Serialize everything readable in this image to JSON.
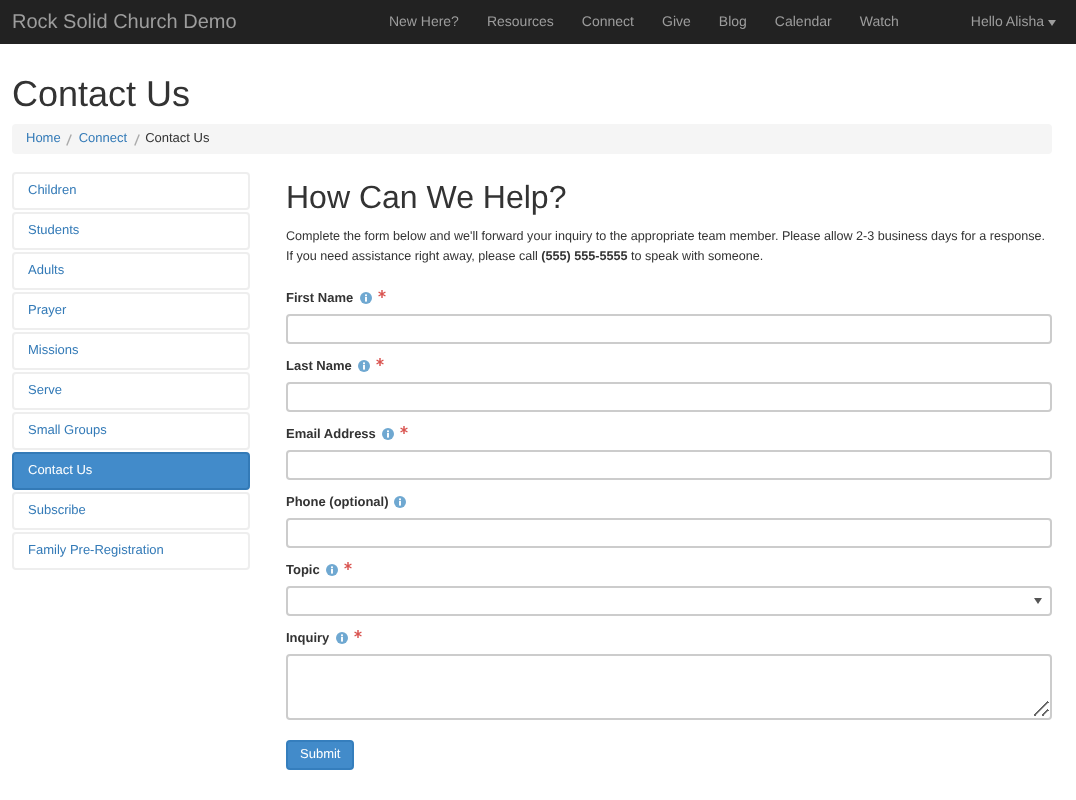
{
  "navbar": {
    "brand": "Rock Solid Church Demo",
    "links": [
      {
        "label": "New Here?"
      },
      {
        "label": "Resources"
      },
      {
        "label": "Connect"
      },
      {
        "label": "Give"
      },
      {
        "label": "Blog"
      },
      {
        "label": "Calendar"
      },
      {
        "label": "Watch"
      }
    ],
    "user": "Hello Alisha"
  },
  "page_title": "Contact Us",
  "breadcrumb": [
    {
      "label": "Home",
      "link": true
    },
    {
      "label": "Connect",
      "link": true
    },
    {
      "label": "Contact Us",
      "link": false
    }
  ],
  "sidebar": {
    "items": [
      {
        "label": "Children",
        "selected": false
      },
      {
        "label": "Students",
        "selected": false
      },
      {
        "label": "Adults",
        "selected": false
      },
      {
        "label": "Prayer",
        "selected": false
      },
      {
        "label": "Missions",
        "selected": false
      },
      {
        "label": "Serve",
        "selected": false
      },
      {
        "label": "Small Groups",
        "selected": false
      },
      {
        "label": "Contact Us",
        "selected": true
      },
      {
        "label": "Subscribe",
        "selected": false
      },
      {
        "label": "Family Pre-Registration",
        "selected": false
      }
    ]
  },
  "form": {
    "heading": "How Can We Help?",
    "intro": "Complete the form below and we'll forward your inquiry to the appropriate team member. Please allow 2-3 business days for a response. If you need assistance right away, please call **(555) 555-5555** to speak with someone.",
    "fields": [
      {
        "label": "First Name",
        "kind": "text",
        "required": true
      },
      {
        "label": "Last Name",
        "kind": "text",
        "required": true
      },
      {
        "label": "Email Address",
        "kind": "text",
        "required": true
      },
      {
        "label": "Phone (optional)",
        "kind": "text",
        "required": false
      },
      {
        "label": "Topic",
        "kind": "select",
        "required": true
      },
      {
        "label": "Inquiry",
        "kind": "textarea",
        "required": true
      }
    ],
    "submit": "Submit"
  }
}
